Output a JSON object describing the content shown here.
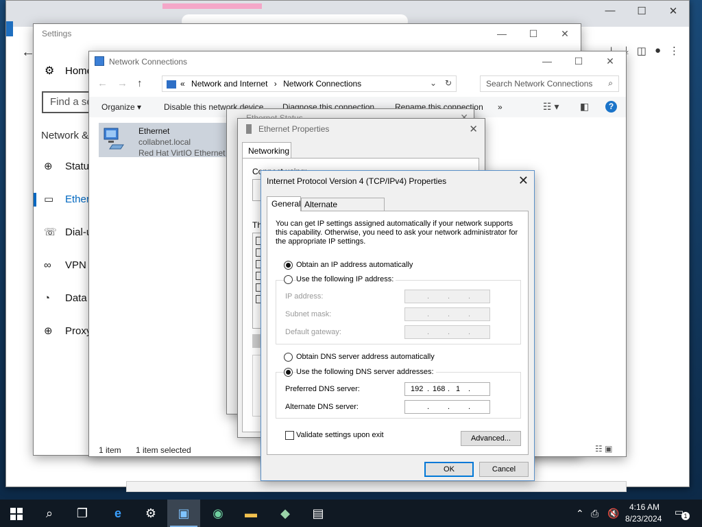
{
  "settings": {
    "title": "Settings",
    "home": "Home",
    "search_placeholder": "Find a se",
    "section": "Network &",
    "nav": [
      {
        "label": "Statu",
        "icon": "globe-icon"
      },
      {
        "label": "Ether",
        "icon": "ethernet-icon"
      },
      {
        "label": "Dial-u",
        "icon": "dialup-icon"
      },
      {
        "label": "VPN",
        "icon": "vpn-icon"
      },
      {
        "label": "Data",
        "icon": "data-usage-icon"
      },
      {
        "label": "Proxy",
        "icon": "globe-icon"
      }
    ]
  },
  "network_connections": {
    "title": "Network Connections",
    "breadcrumb_prefix": "«",
    "breadcrumb_1": "Network and Internet",
    "breadcrumb_sep": "›",
    "breadcrumb_2": "Network Connections",
    "search_placeholder": "Search Network Connections",
    "commands": {
      "organize": "Organize ▾",
      "disable": "Disable this network device",
      "diagnose": "Diagnose this connection",
      "rename": "Rename this connection",
      "more": "»"
    },
    "item": {
      "name": "Ethernet",
      "domain": "collabnet.local",
      "device": "Red Hat VirtIO Ethernet A"
    },
    "status_count": "1 item",
    "status_selected": "1 item selected"
  },
  "ethernet_status": {
    "title": "Ethernet Status"
  },
  "ethernet_properties": {
    "title": "Ethernet Properties",
    "tab": "Networking",
    "connect_using_label": "Connect using:",
    "items_label": "Th"
  },
  "ipv4": {
    "title": "Internet Protocol Version 4 (TCP/IPv4) Properties",
    "tabs": {
      "general": "General",
      "alternate": "Alternate Configuration"
    },
    "intro": "You can get IP settings assigned automatically if your network supports this capability. Otherwise, you need to ask your network administrator for the appropriate IP settings.",
    "obtain_ip": "Obtain an IP address automatically",
    "use_ip": "Use the following IP address:",
    "ip_label": "IP address:",
    "mask_label": "Subnet mask:",
    "gateway_label": "Default gateway:",
    "obtain_dns": "Obtain DNS server address automatically",
    "use_dns": "Use the following DNS server addresses:",
    "preferred_label": "Preferred DNS server:",
    "preferred_octets": [
      "192",
      "168",
      "1",
      ""
    ],
    "alternate_label": "Alternate DNS server:",
    "validate": "Validate settings upon exit",
    "advanced": "Advanced...",
    "ok": "OK",
    "cancel": "Cancel"
  },
  "taskbar": {
    "time": "4:16 AM",
    "date": "8/23/2024",
    "notification_count": "1"
  }
}
